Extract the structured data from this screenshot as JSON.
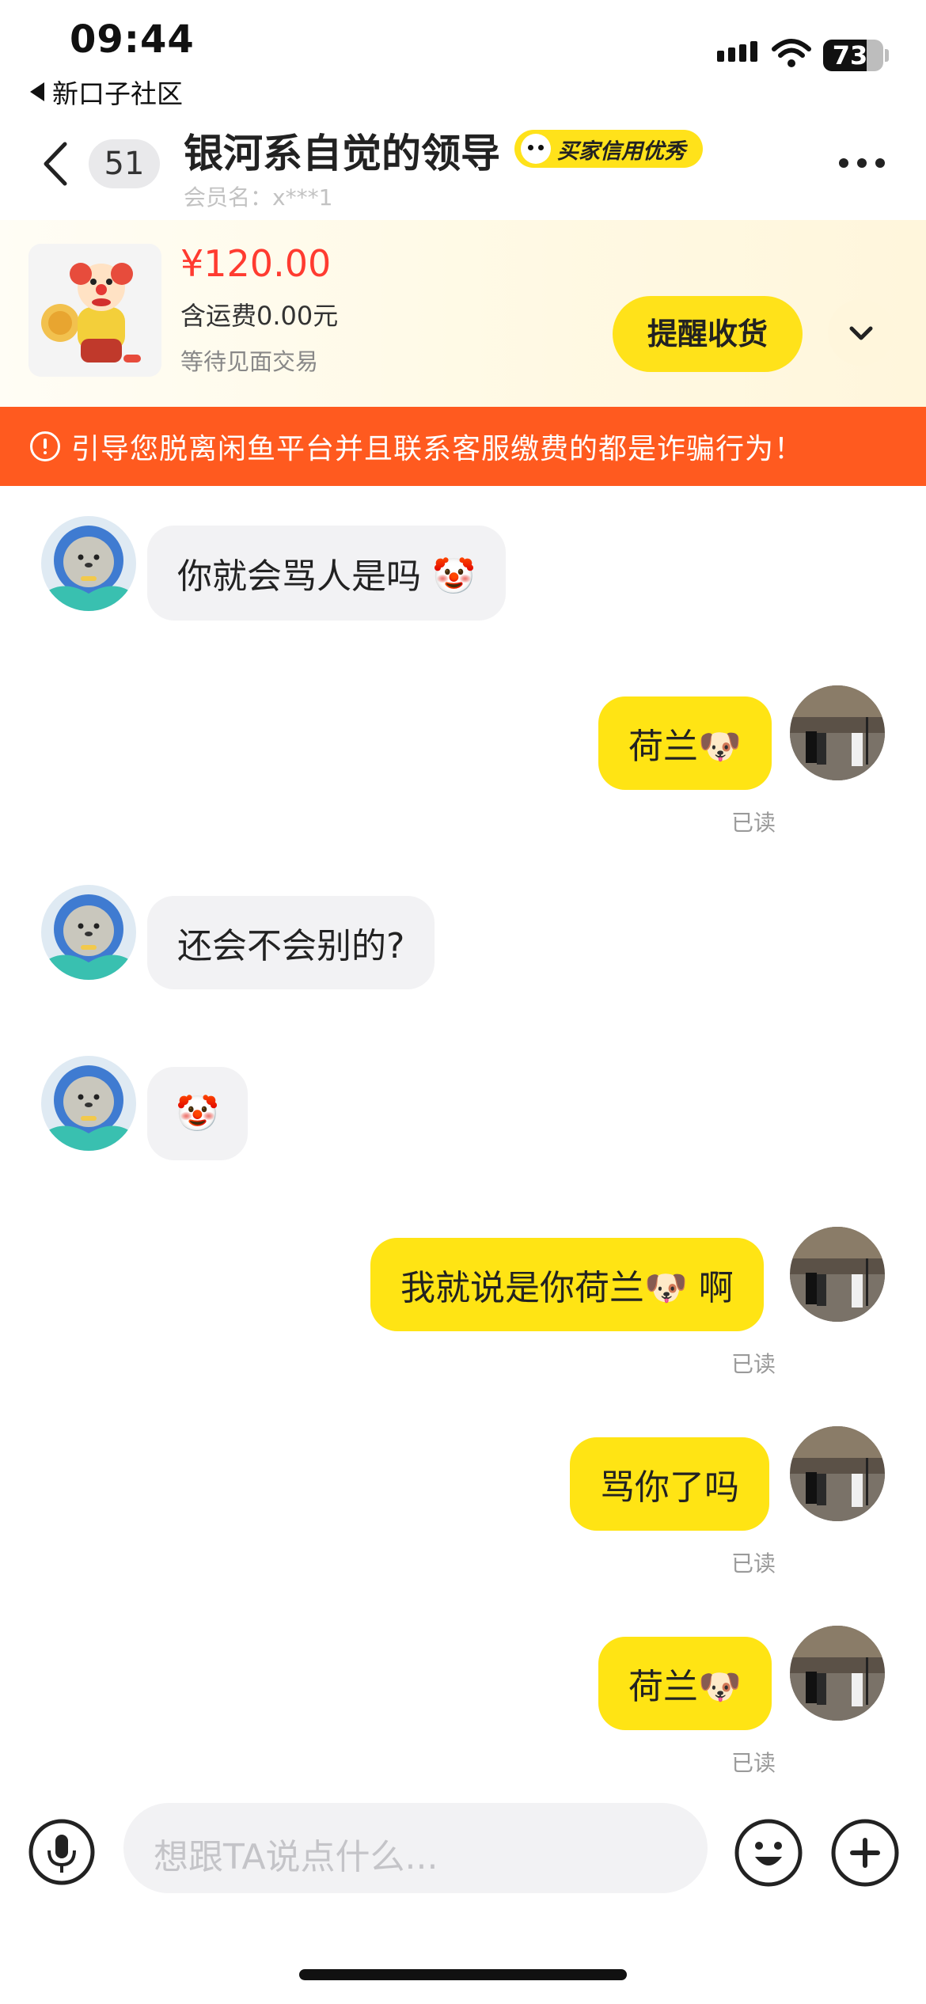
{
  "status_bar": {
    "time": "09:44",
    "back_app": "新口子社区",
    "battery": "73"
  },
  "header": {
    "unread_count": "51",
    "title": "银河系自觉的领导",
    "credit_badge": "买家信用优秀",
    "member_name": "会员名：x***1"
  },
  "product": {
    "price": "¥120.00",
    "shipping": "含运费0.00元",
    "status": "等待见面交易",
    "action_label": "提醒收货"
  },
  "warning": "引导您脱离闲鱼平台并且联系客服缴费的都是诈骗行为！",
  "messages": [
    {
      "from": "them",
      "text": "你就会骂人是吗 🤡"
    },
    {
      "from": "me",
      "text": "荷兰🐶",
      "status": "已读"
    },
    {
      "from": "them",
      "text": "还会不会别的?"
    },
    {
      "from": "them",
      "text": "🤡"
    },
    {
      "from": "me",
      "text": "我就说是你荷兰🐶 啊",
      "status": "已读"
    },
    {
      "from": "me",
      "text": "骂你了吗",
      "status": "已读"
    },
    {
      "from": "me",
      "text": "荷兰🐶",
      "status": "已读"
    }
  ],
  "composer": {
    "placeholder": "想跟TA说点什么..."
  },
  "icons": {
    "back": "chevron-left-icon",
    "more": "more-icon",
    "expand": "chevron-down-icon",
    "warning": "alert-circle-icon",
    "voice": "mic-icon",
    "emoji": "smiley-icon",
    "add": "plus-icon"
  },
  "colors": {
    "accent_yellow": "#ffe414",
    "warning_bg": "#ff5a1f",
    "price_red": "#ff3b30"
  }
}
